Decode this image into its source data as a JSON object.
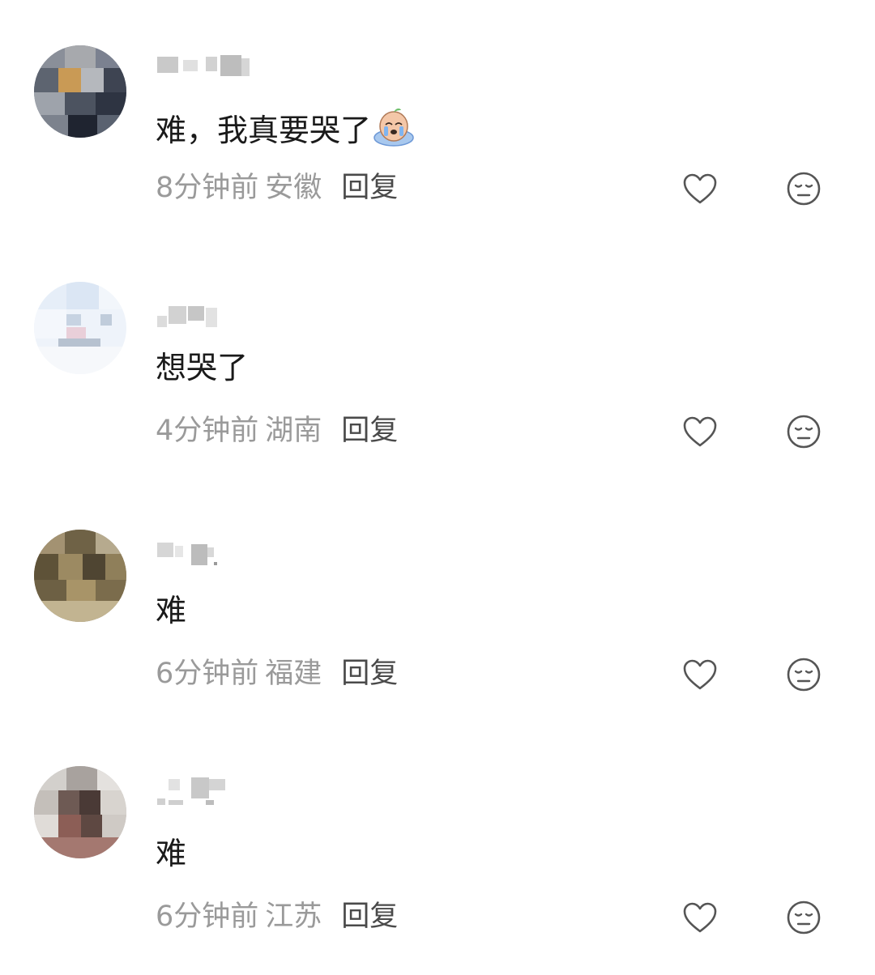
{
  "comments": [
    {
      "text": "难，我真要哭了",
      "emoji": "crying-face-sticker",
      "time": "8分钟前",
      "location": "安徽",
      "reply": "回复"
    },
    {
      "text": "想哭了",
      "time": "4分钟前",
      "location": "湖南",
      "reply": "回复"
    },
    {
      "text": "难",
      "time": "6分钟前",
      "location": "福建",
      "reply": "回复"
    },
    {
      "text": "难",
      "time": "6分钟前",
      "location": "江苏",
      "reply": "回复"
    }
  ],
  "icons": {
    "like": "heart-outline-icon",
    "dislike": "neutral-face-icon"
  },
  "colors": {
    "text": "#1a1a1a",
    "meta": "#9a9a9a",
    "reply": "#4a4a4a",
    "icon": "#555555"
  }
}
